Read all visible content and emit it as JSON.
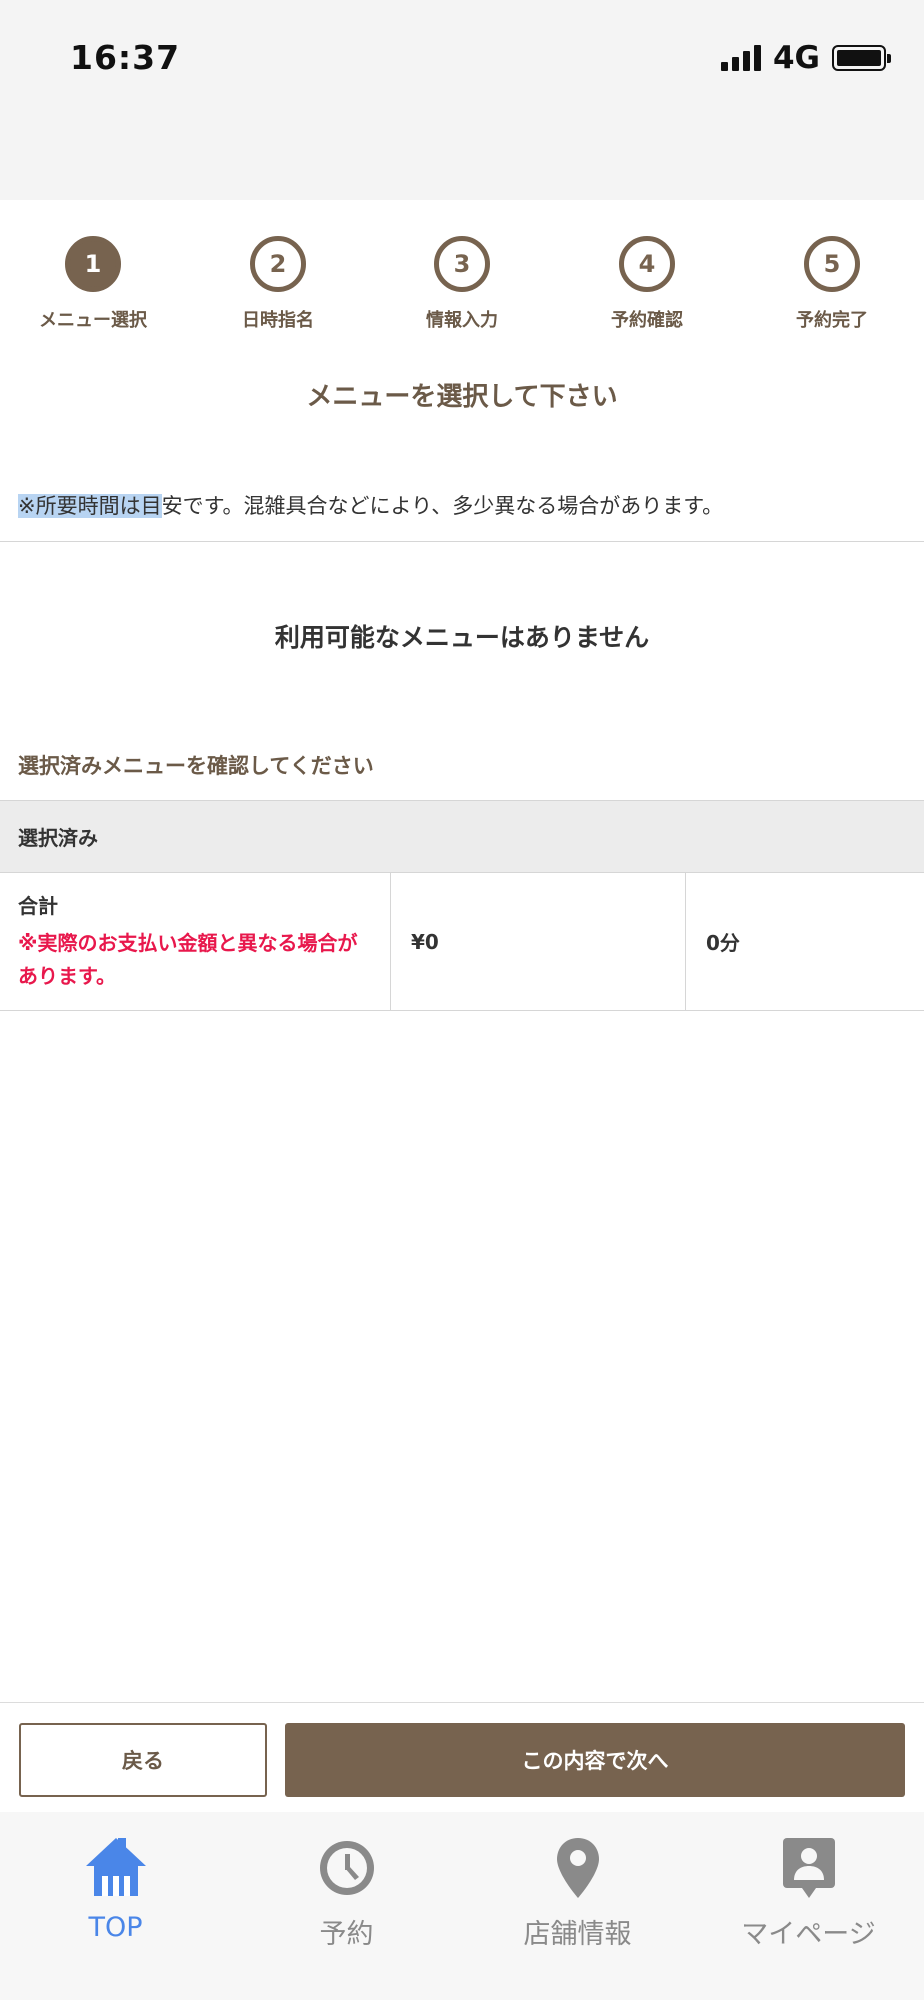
{
  "status_bar": {
    "time": "16:37",
    "network": "4G"
  },
  "steps": [
    {
      "number": "1",
      "label": "メニュー選択",
      "active": true
    },
    {
      "number": "2",
      "label": "日時指名",
      "active": false
    },
    {
      "number": "3",
      "label": "情報入力",
      "active": false
    },
    {
      "number": "4",
      "label": "予約確認",
      "active": false
    },
    {
      "number": "5",
      "label": "予約完了",
      "active": false
    }
  ],
  "page_heading": "メニューを選択して下さい",
  "notice": {
    "highlighted": "※所要時間は目",
    "rest": "安です。混雑具合などにより、多少異なる場合があります。"
  },
  "empty_message": "利用可能なメニューはありません",
  "confirm_title": "選択済みメニューを確認してください",
  "selected_header": "選択済み",
  "total": {
    "label": "合計",
    "warning": "※実際のお支払い金額と異なる場合があります。",
    "price": "¥0",
    "duration": "0分"
  },
  "buttons": {
    "back": "戻る",
    "next": "この内容で次へ"
  },
  "tabbar": [
    {
      "label": "TOP",
      "icon": "home-icon",
      "active": true
    },
    {
      "label": "予約",
      "icon": "clock-icon",
      "active": false
    },
    {
      "label": "店舗情報",
      "icon": "map-pin-icon",
      "active": false
    },
    {
      "label": "マイページ",
      "icon": "user-icon",
      "active": false
    }
  ],
  "colors": {
    "brand": "#77634f",
    "warning": "#e8184c",
    "tab_active": "#4a86e8",
    "tab_inactive": "#8a8a8a"
  }
}
